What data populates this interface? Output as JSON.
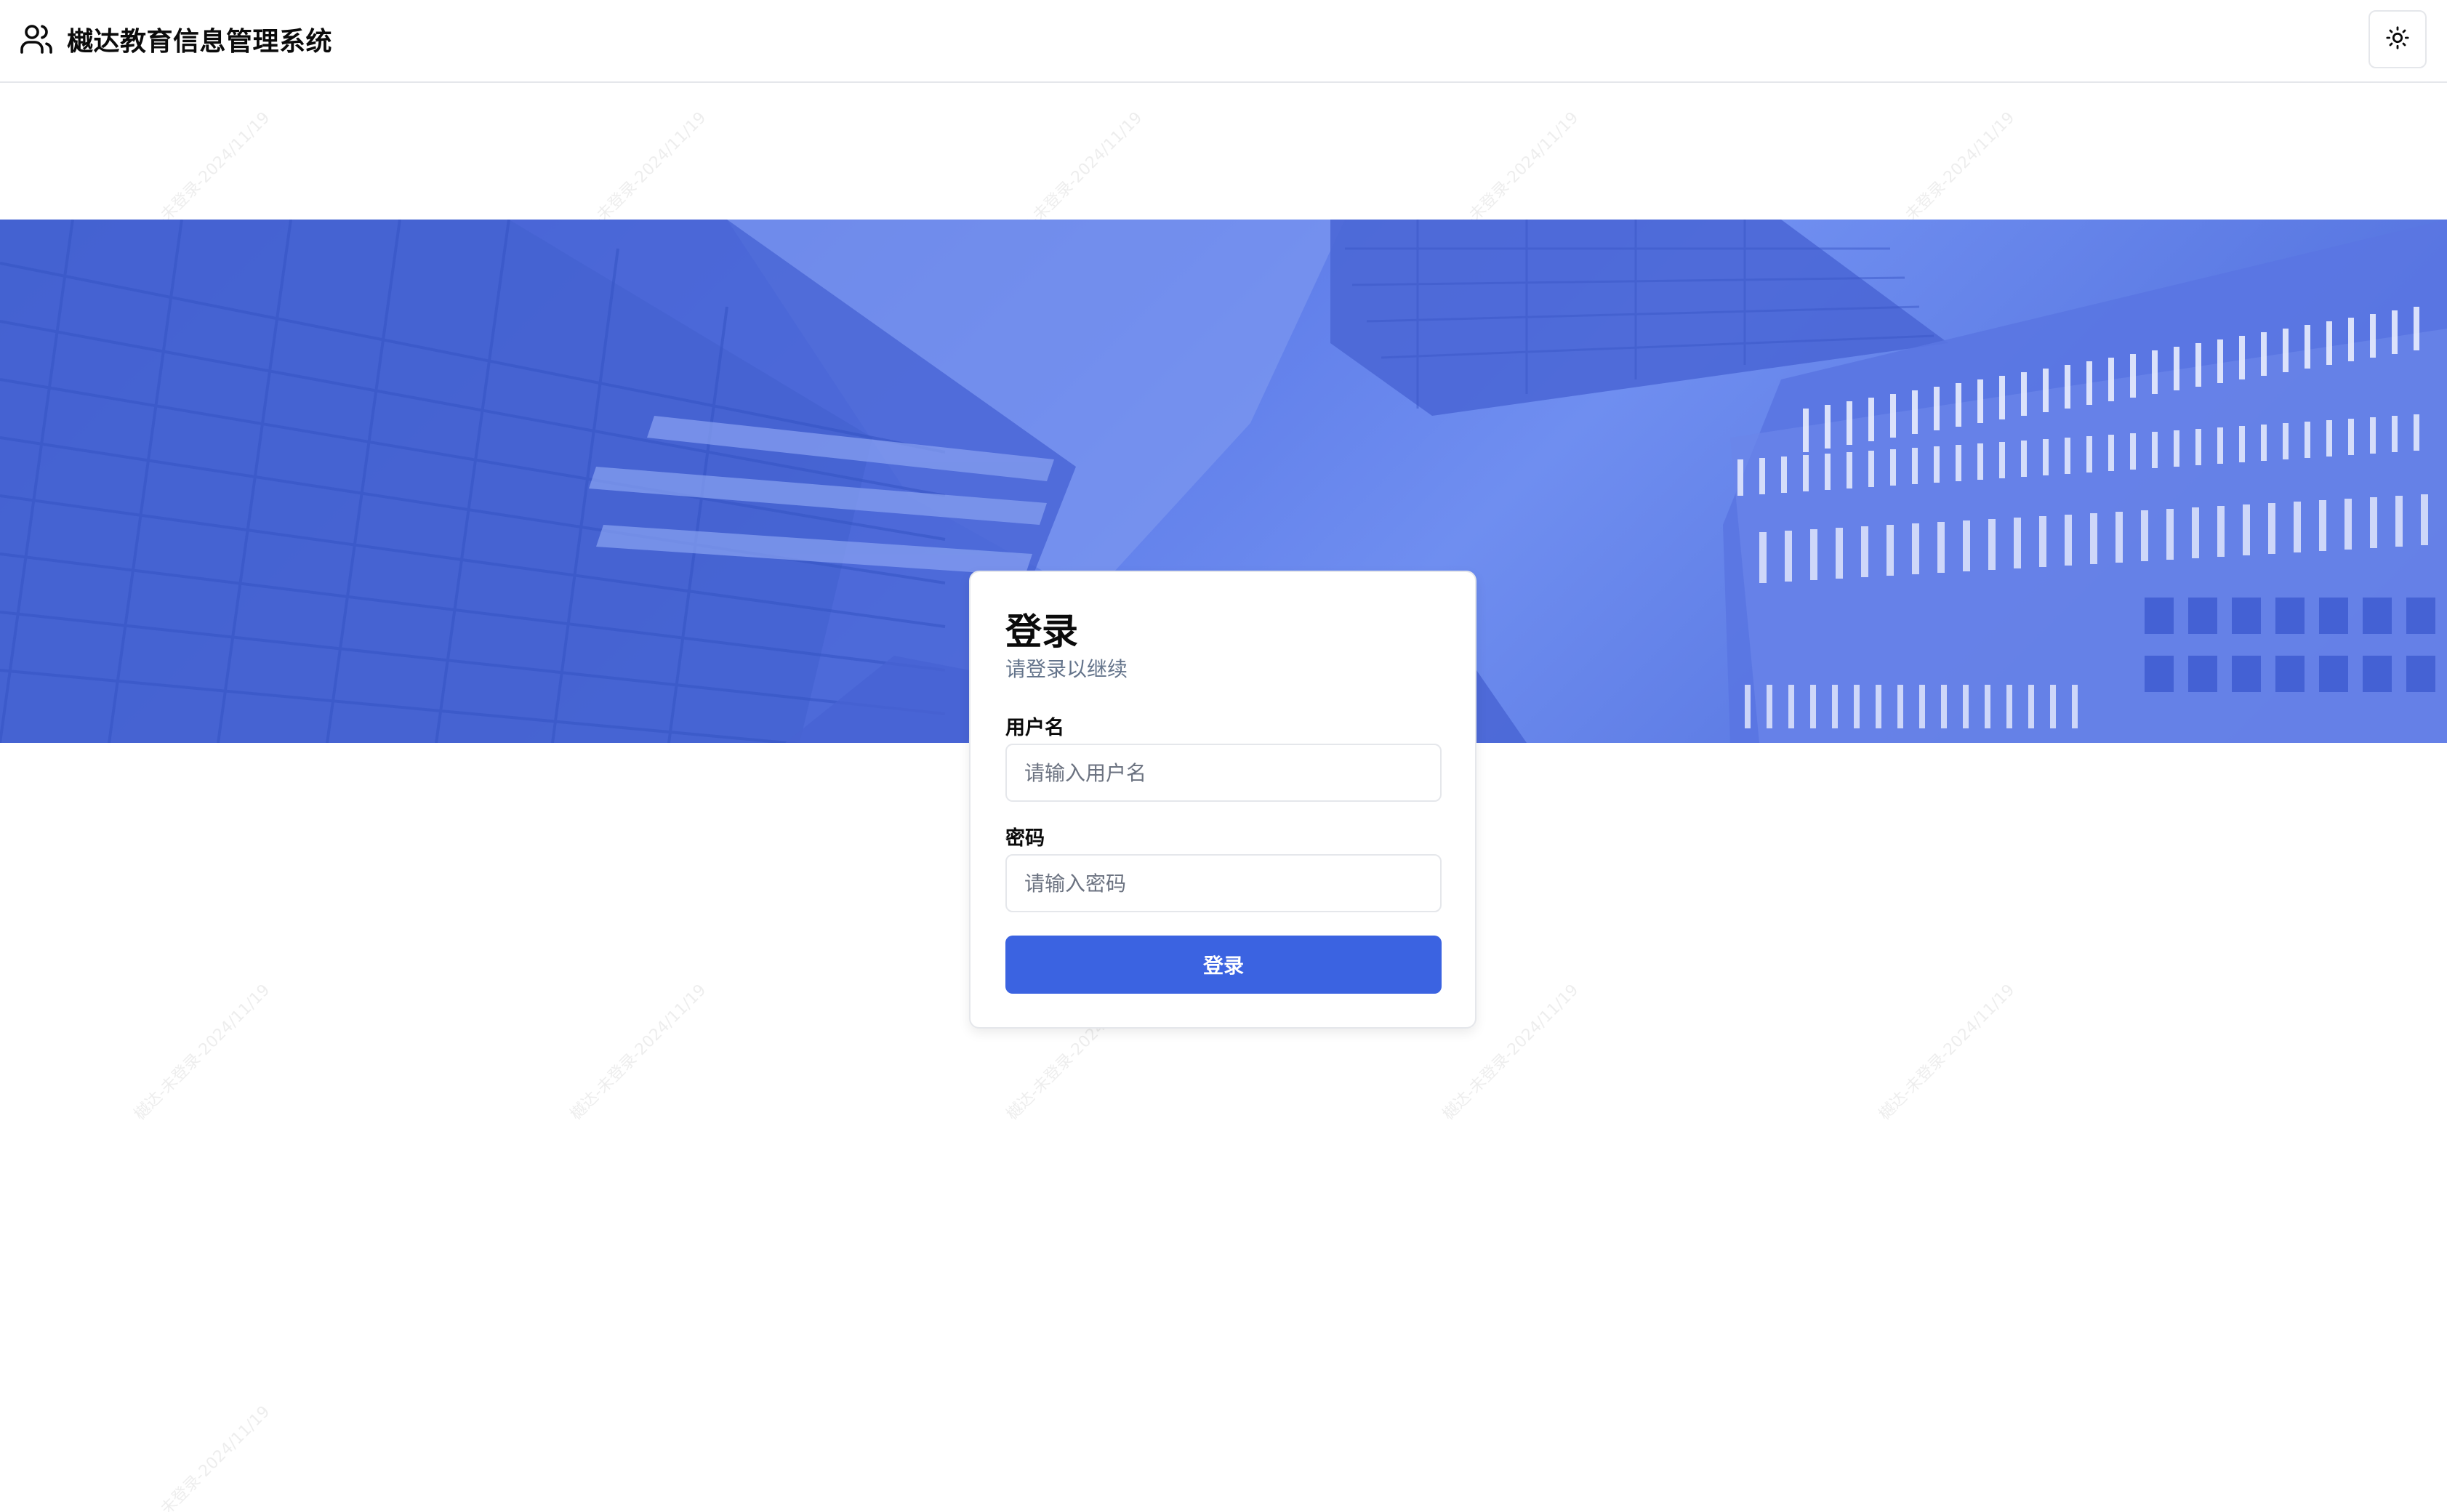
{
  "header": {
    "title": "樾达教育信息管理系统",
    "user_icon": "user-icon",
    "theme_toggle_icon": "sun-icon"
  },
  "watermark": {
    "text": "樾达-未登录-2024/11/19"
  },
  "login": {
    "title": "登录",
    "subtitle": "请登录以继续",
    "username_label": "用户名",
    "username_placeholder": "请输入用户名",
    "username_value": "",
    "password_label": "密码",
    "password_placeholder": "请输入密码",
    "password_value": "",
    "submit_label": "登录"
  },
  "colors": {
    "accent": "#3b63e1",
    "banner_base": "#5c7ae8",
    "text_primary": "#0b0b0b",
    "text_muted": "#64748b",
    "border": "#e5e7eb"
  }
}
